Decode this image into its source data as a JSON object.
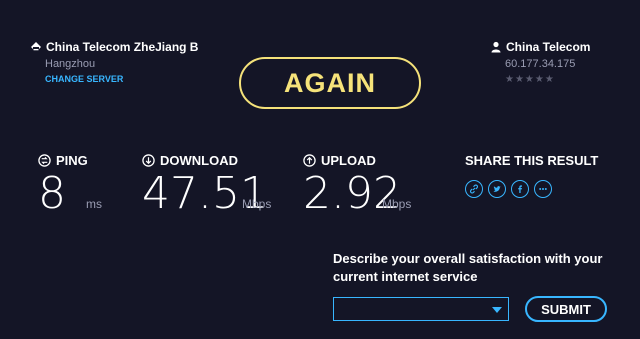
{
  "server": {
    "name": "China Telecom ZheJiang B",
    "location": "Hangzhou",
    "change_label": "CHANGE SERVER",
    "icon": "server-icon"
  },
  "isp": {
    "name": "China Telecom",
    "ip": "60.177.34.175",
    "rating": "★★★★★",
    "icon": "user-icon"
  },
  "again_label": "AGAIN",
  "metrics": {
    "ping": {
      "label": "PING",
      "value": "8",
      "unit": "ms",
      "icon": "ping-icon"
    },
    "download": {
      "label": "DOWNLOAD",
      "value": "47.51",
      "unit": "Mbps",
      "icon": "download-icon"
    },
    "upload": {
      "label": "UPLOAD",
      "value": "2.92",
      "unit": "Mbps",
      "icon": "upload-icon"
    }
  },
  "share": {
    "title": "SHARE THIS RESULT",
    "icons": [
      "link-icon",
      "twitter-icon",
      "facebook-icon",
      "more-icon"
    ]
  },
  "survey": {
    "question": "Describe your overall satisfaction with your current internet service",
    "selected": "",
    "submit_label": "SUBMIT"
  },
  "colors": {
    "background": "#141526",
    "accent": "#38b6ff",
    "again": "#f6e37a",
    "muted": "#9a9db3"
  }
}
